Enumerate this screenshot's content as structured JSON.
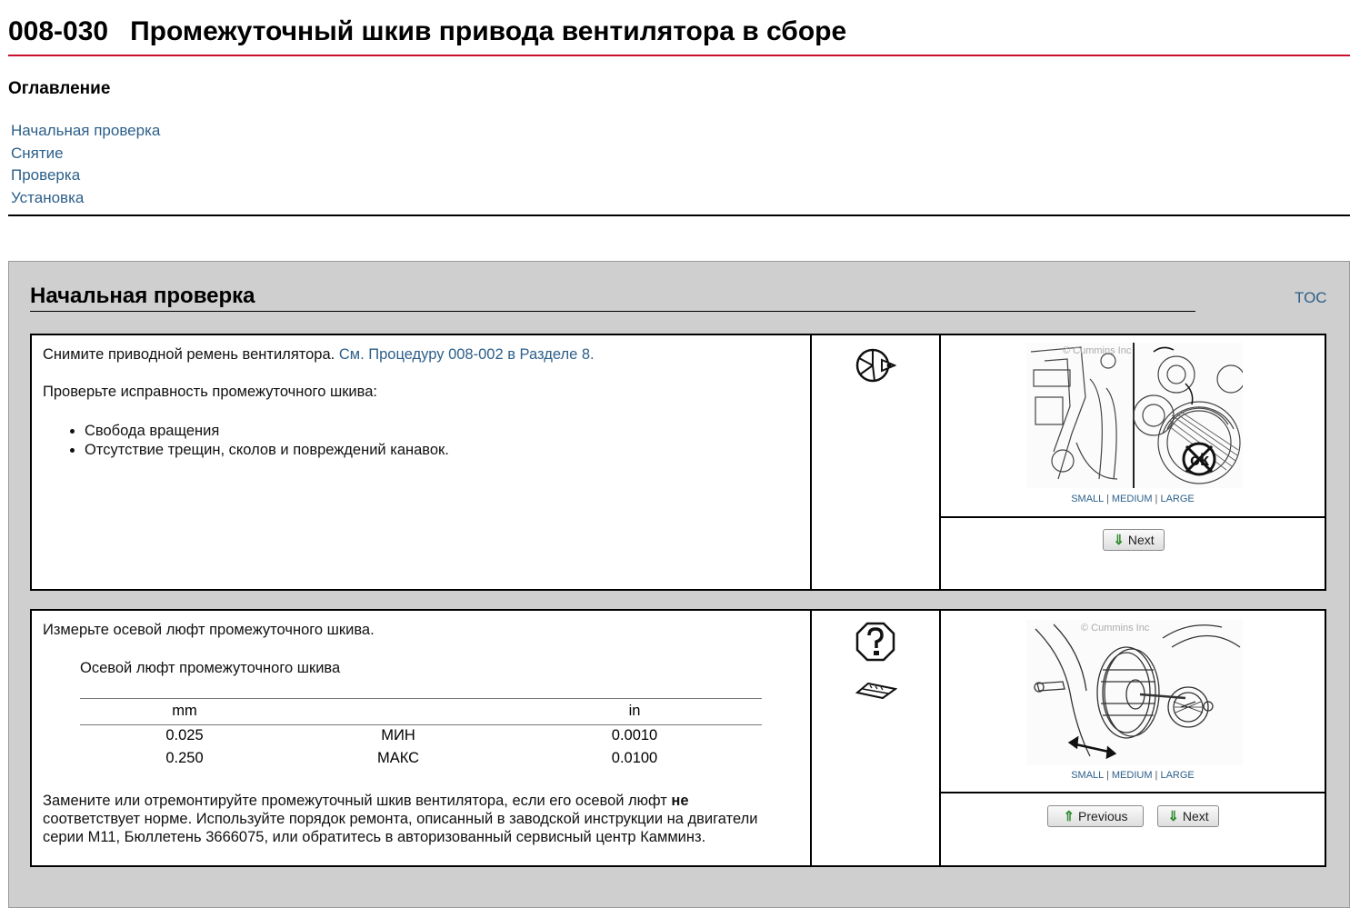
{
  "header": {
    "code": "008-030",
    "title": "Промежуточный шкив привода вентилятора в сборе"
  },
  "toc": {
    "heading": "Оглавление",
    "items": [
      {
        "label": "Начальная проверка"
      },
      {
        "label": "Снятие"
      },
      {
        "label": "Проверка"
      },
      {
        "label": "Установка"
      }
    ]
  },
  "section": {
    "title": "Начальная проверка",
    "toc_link": "TOC"
  },
  "step1": {
    "line1_text": "Снимите приводной ремень вентилятора.",
    "line1_link": "См. Процедуру 008-002 в Разделе 8.",
    "line2": "Проверьте исправность промежуточного шкива:",
    "bullets": [
      "Свобода вращения",
      "Отсутствие трещин, сколов и повреждений канавок."
    ],
    "icons": [
      "inspect-icon"
    ],
    "size_links": {
      "small": "SMALL",
      "medium": "MEDIUM",
      "large": "LARGE",
      "sep": "|"
    },
    "next_label": "Next",
    "watermark": "© Cummins Inc"
  },
  "step2": {
    "line1": "Измерьте осевой люфт промежуточного шкива.",
    "spec_name": "Осевой люфт промежуточного шкива",
    "table": {
      "headers": [
        "mm",
        "",
        "in"
      ],
      "rows": [
        [
          "0.025",
          "МИН",
          "0.0010"
        ],
        [
          "0.250",
          "МАКС",
          "0.0100"
        ]
      ]
    },
    "note_line1_pre": "Замените или отремонтируйте промежуточный шкив вентилятора, если его осевой люфт",
    "note_line1_bold": "не",
    "note_line2": "соответствует норме. Используйте порядок ремонта, описанный в заводской инструкции на двигатели",
    "note_line3": "серии М11, Бюллетень 3666075, или обратитесь в авторизованный сервисный центр Камминз.",
    "icons": [
      "question-icon",
      "measure-icon"
    ],
    "size_links": {
      "small": "SMALL",
      "medium": "MEDIUM",
      "large": "LARGE",
      "sep": "|"
    },
    "previous_label": "Previous",
    "next_label": "Next",
    "watermark": "© Cummins Inc"
  }
}
